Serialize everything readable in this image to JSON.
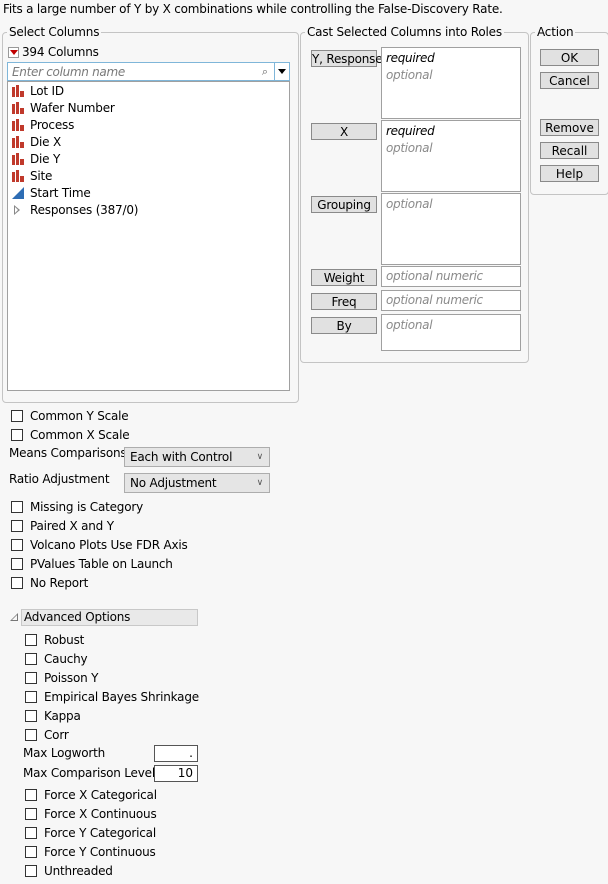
{
  "description": "Fits a large number of Y by X combinations while controlling the False-Discovery Rate.",
  "select_columns": {
    "title": "Select Columns",
    "count_label": "394 Columns",
    "search_placeholder": "Enter column name",
    "columns": [
      {
        "name": "Lot ID",
        "type": "nominal"
      },
      {
        "name": "Wafer Number",
        "type": "nominal"
      },
      {
        "name": "Process",
        "type": "nominal"
      },
      {
        "name": "Die X",
        "type": "nominal"
      },
      {
        "name": "Die Y",
        "type": "nominal"
      },
      {
        "name": "Site",
        "type": "nominal"
      },
      {
        "name": "Start Time",
        "type": "continuous"
      },
      {
        "name": "Responses (387/0)",
        "type": "group"
      }
    ]
  },
  "cast_roles": {
    "title": "Cast Selected Columns into Roles",
    "roles": [
      {
        "label": "Y, Response",
        "required": "required",
        "optional": "optional"
      },
      {
        "label": "X",
        "required": "required",
        "optional": "optional"
      },
      {
        "label": "Grouping",
        "optional": "optional"
      },
      {
        "label": "Weight",
        "optional": "optional numeric"
      },
      {
        "label": "Freq",
        "optional": "optional numeric"
      },
      {
        "label": "By",
        "optional": "optional"
      }
    ]
  },
  "action": {
    "title": "Action",
    "buttons": [
      "OK",
      "Cancel",
      "Remove",
      "Recall",
      "Help"
    ]
  },
  "options": {
    "common_y_scale": "Common Y Scale",
    "common_x_scale": "Common X Scale",
    "means_comparisons_label": "Means Comparisons",
    "means_comparisons_value": "Each with Control",
    "ratio_adjustment_label": "Ratio Adjustment",
    "ratio_adjustment_value": "No Adjustment",
    "checks": [
      "Missing is Category",
      "Paired X and Y",
      "Volcano Plots Use FDR Axis",
      "PValues Table on Launch",
      "No Report"
    ]
  },
  "advanced": {
    "title": "Advanced Options",
    "checks_top": [
      "Robust",
      "Cauchy",
      "Poisson Y",
      "Empirical Bayes Shrinkage",
      "Kappa",
      "Corr"
    ],
    "max_logworth_label": "Max Logworth",
    "max_logworth_value": ".",
    "max_comparison_levels_label": "Max Comparison Levels",
    "max_comparison_levels_value": "10",
    "checks_bottom": [
      "Force X Categorical",
      "Force X Continuous",
      "Force Y Categorical",
      "Force Y Continuous",
      "Unthreaded"
    ]
  }
}
